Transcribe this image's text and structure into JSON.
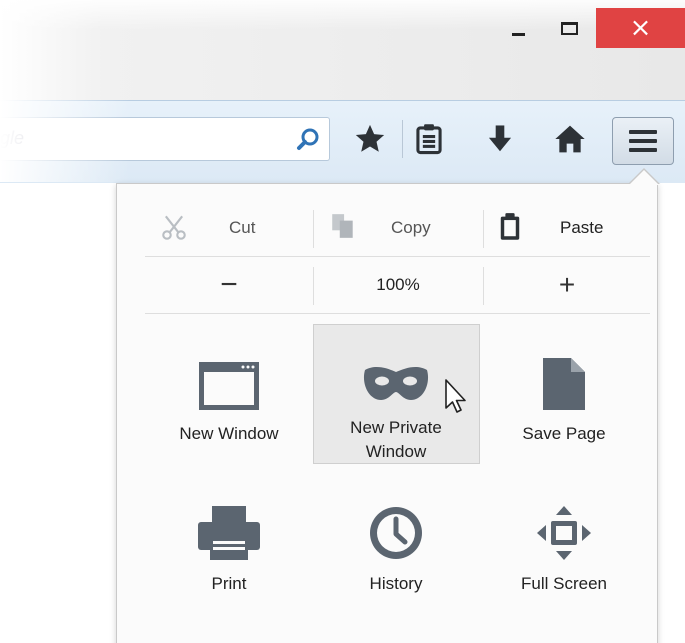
{
  "window_controls": {
    "minimize": "minimize",
    "maximize": "maximize",
    "close": "×"
  },
  "search": {
    "placeholder": "gle"
  },
  "toolbar": {
    "icons": [
      "search-icon",
      "star-icon",
      "reading-list-icon",
      "download-icon",
      "home-icon",
      "menu-icon"
    ]
  },
  "menu": {
    "edit": {
      "cut": "Cut",
      "copy": "Copy",
      "paste": "Paste"
    },
    "zoom": {
      "minus": "−",
      "level": "100%",
      "plus": "+"
    },
    "items": [
      {
        "label": "New Window",
        "icon": "window-icon"
      },
      {
        "label": "New Private Window",
        "icon": "mask-icon"
      },
      {
        "label": "Save Page",
        "icon": "document-icon"
      },
      {
        "label": "Print",
        "icon": "printer-icon"
      },
      {
        "label": "History",
        "icon": "clock-icon"
      },
      {
        "label": "Full Screen",
        "icon": "fullscreen-icon"
      }
    ]
  },
  "colors": {
    "icon": "#5b6570",
    "close": "#e04343",
    "toolbar": "#dfeaf5"
  }
}
